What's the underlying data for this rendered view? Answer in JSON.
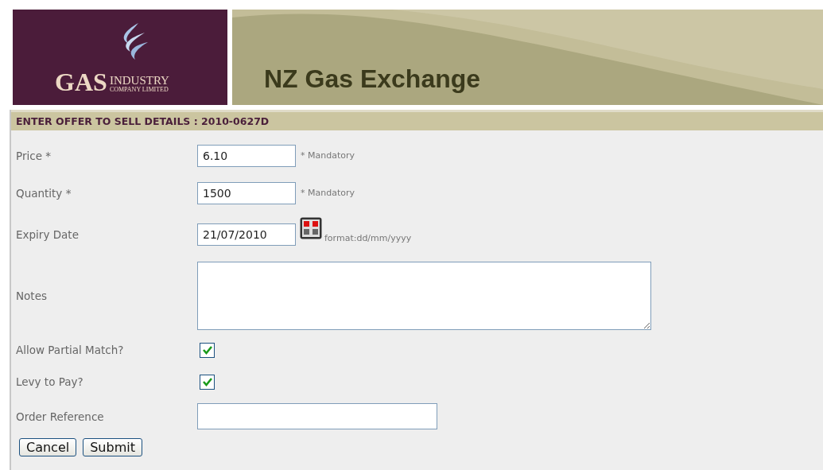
{
  "header": {
    "logo": {
      "word": "GAS",
      "word2": "INDUSTRY",
      "tagline": "COMPANY LIMITED"
    },
    "title": "NZ Gas Exchange"
  },
  "section_title": "ENTER OFFER TO SELL DETAILS : 2010-0627D",
  "fields": [
    {
      "kind": "text",
      "label": "Price *",
      "value": "6.10",
      "hint": "* Mandatory"
    },
    {
      "kind": "text",
      "label": "Quantity *",
      "value": "1500",
      "hint": "* Mandatory"
    },
    {
      "kind": "date",
      "label": "Expiry Date",
      "value": "21/07/2010",
      "hint": "format:dd/mm/yyyy"
    },
    {
      "kind": "textarea",
      "label": "Notes"
    },
    {
      "kind": "checkbox",
      "label": "Allow Partial Match?",
      "checked": true
    },
    {
      "kind": "checkbox",
      "label": "Levy to Pay?",
      "checked": true
    },
    {
      "kind": "wide",
      "label": "Order Reference"
    }
  ],
  "buttons": [
    "Cancel",
    "Submit"
  ]
}
